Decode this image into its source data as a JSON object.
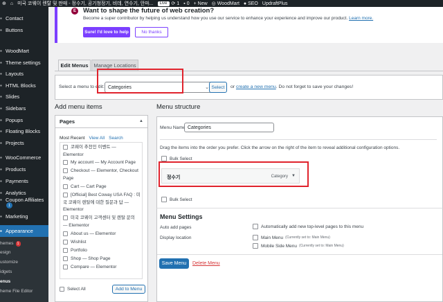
{
  "adminbar": {
    "site_title": "미국 코웨이 렌탈 및 판매 - 정수기, 공기청정기, 비데, 연수기, 안마...",
    "live": "Live",
    "updates_count": "1",
    "comments_count": "0",
    "new_label": "New",
    "woodmart": "WoodMart",
    "seo": "SEO",
    "updraft": "UpdraftPlus"
  },
  "sidebar": {
    "items": [
      {
        "label": "Contact",
        "icon": "envelope-icon"
      },
      {
        "label": "Buttons",
        "icon": "button-icon"
      },
      {
        "label": "WoodMart",
        "icon": "woodmart-icon"
      },
      {
        "label": "Theme settings",
        "icon": "gear-icon"
      },
      {
        "label": "Layouts",
        "icon": "layout-icon"
      },
      {
        "label": "HTML Blocks",
        "icon": "code-icon"
      },
      {
        "label": "Slides",
        "icon": "slides-icon"
      },
      {
        "label": "Sidebars",
        "icon": "sidebar-icon"
      },
      {
        "label": "Popups",
        "icon": "popup-icon"
      },
      {
        "label": "Floating Blocks",
        "icon": "blocks-icon"
      },
      {
        "label": "Projects",
        "icon": "projects-icon"
      },
      {
        "label": "WooCommerce",
        "icon": "woocommerce-icon"
      },
      {
        "label": "Products",
        "icon": "products-icon"
      },
      {
        "label": "Payments",
        "icon": "payments-icon"
      },
      {
        "label": "Analytics",
        "icon": "analytics-icon"
      },
      {
        "label": "Coupon Affiliates",
        "icon": "coupon-icon"
      },
      {
        "label": "Marketing",
        "icon": "marketing-icon"
      },
      {
        "label": "Appearance",
        "icon": "appearance-icon"
      }
    ],
    "coupon_badge": "1",
    "submenu": [
      {
        "label": "hemes",
        "badge": "1"
      },
      {
        "label": "esign"
      },
      {
        "label": "ustomize"
      },
      {
        "label": "idgets"
      },
      {
        "label": "enus"
      },
      {
        "label": "heme File Editor"
      }
    ]
  },
  "notice": {
    "logo": "E",
    "title": "Want to shape the future of web creation?",
    "text": "Become a super contributor by helping us understand how you use our service to enhance your experience and improve our product.",
    "learn_more": "Learn more.",
    "primary_button": "Sure! I'd love to help",
    "secondary_button": "No thanks"
  },
  "tabs": {
    "edit_menus": "Edit Menus",
    "manage_locations": "Manage Locations"
  },
  "select_bar": {
    "label": "Select a menu to edit:",
    "selected": "Categories",
    "button": "Select",
    "or": "or",
    "create_link": "create a new menu",
    "reminder": ". Do not forget to save your changes!"
  },
  "add_menu_items": {
    "heading": "Add menu items",
    "pages_title": "Pages",
    "tab_recent": "Most Recent",
    "tab_view_all": "View All",
    "tab_search": "Search",
    "pages": [
      {
        "lines": [
          "코웨이 추천인 이벤트 —",
          "Elementor"
        ]
      },
      {
        "lines": [
          "My account — My Account Page"
        ]
      },
      {
        "lines": [
          "Checkout — Elementor, Checkout",
          "Page"
        ]
      },
      {
        "lines": [
          "Cart — Cart Page"
        ]
      },
      {
        "lines": [
          "[Official] Best Coway USA FAQ : 미",
          "국 코웨이 렌탈에 대한 질문과 답 —",
          "Elementor"
        ]
      },
      {
        "lines": [
          "미국 코웨이 고객센터 및 렌탈 문의",
          "— Elementor"
        ]
      },
      {
        "lines": [
          "About us — Elementor"
        ]
      },
      {
        "lines": [
          "Wishlist"
        ]
      },
      {
        "lines": [
          "Portfolio"
        ]
      },
      {
        "lines": [
          "Shop — Shop Page"
        ]
      },
      {
        "lines": [
          "Compare — Elementor"
        ]
      }
    ],
    "select_all": "Select All",
    "add_button": "Add to Menu"
  },
  "menu_structure": {
    "heading": "Menu structure",
    "name_label": "Menu Name",
    "name_value": "Categories",
    "instructions": "Drag the items into the order you prefer. Click the arrow on the right of the item to reveal additional configuration options.",
    "bulk_select": "Bulk Select",
    "item_title": "정수기",
    "item_type": "Category",
    "settings_title": "Menu Settings",
    "auto_add_label": "Auto add pages",
    "auto_add_option": "Automatically add new top-level pages to this menu",
    "display_label": "Display location",
    "locations": [
      {
        "name": "Main Menu",
        "note": "(Currently set to: Main Menu)"
      },
      {
        "name": "Mobile Side Menu",
        "note": "(Currently set to: Main Menu)"
      }
    ],
    "save_button": "Save Menu",
    "delete_link": "Delete Menu"
  }
}
